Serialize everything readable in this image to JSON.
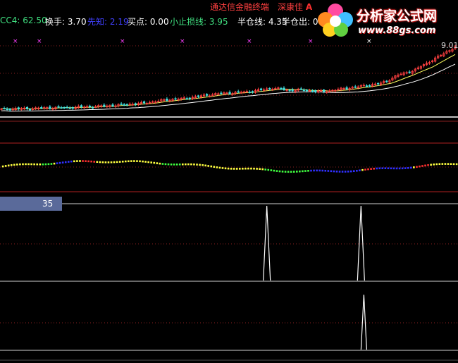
{
  "window": {
    "terminal_title": "通达信金融终端",
    "stock_name": "深康佳",
    "stock_flag": "A"
  },
  "indicators": [
    {
      "text": "CC4: 62.50",
      "color": "#40e080"
    },
    {
      "text": "换手: 3.70",
      "color": "#ffffff"
    },
    {
      "text": "先知: 2.19",
      "color": "#4040ff"
    },
    {
      "text": "买点: 0.00",
      "color": "#ffffff"
    },
    {
      "text": "小止损线: 3.95",
      "color": "#40e080"
    },
    {
      "text": "半仓线: 4.35",
      "color": "#ffffff"
    },
    {
      "text": "半仓出: 0",
      "color": "#ffffff"
    }
  ],
  "watermark": {
    "name": "分析家公式网",
    "url": "www.88gs.com"
  },
  "price_label": "9.01",
  "box_label": "35",
  "chart_data": [
    {
      "type": "candlestick",
      "panel": "main-kline",
      "bars": 160,
      "close_series": [
        3.7,
        3.72,
        3.75,
        3.73,
        3.78,
        3.8,
        3.82,
        3.85,
        3.83,
        3.87,
        3.9,
        3.92,
        3.95,
        4.0,
        4.05,
        4.1,
        4.15,
        4.2,
        4.3,
        4.4,
        4.5,
        4.55,
        4.6,
        4.7,
        4.8,
        4.9,
        5.0,
        5.05,
        5.1,
        5.15,
        5.2,
        5.3,
        5.4,
        5.5,
        5.4,
        5.3,
        5.35,
        5.3,
        5.25,
        5.2,
        5.3,
        5.4,
        5.5,
        5.6,
        5.7,
        5.8,
        5.9,
        6.2,
        6.6,
        6.8,
        7.0,
        7.4,
        7.8,
        8.2,
        8.6,
        9.01
      ],
      "moving_average_colors": [
        "#ffff60",
        "#ffffff"
      ]
    },
    {
      "type": "scatter",
      "panel": "color-dot-band",
      "colors": {
        "up": "#ffff40",
        "strong": "#40ff40",
        "weak": "#3030ff",
        "down": "#ff3030"
      }
    },
    {
      "type": "line",
      "panel": "spike-panel-1",
      "ylim": [
        0,
        35
      ],
      "spikes": [
        {
          "bar": 93,
          "value": 35
        },
        {
          "bar": 126,
          "value": 35
        }
      ]
    },
    {
      "type": "line",
      "panel": "spike-panel-2",
      "ylim": [
        0,
        1
      ],
      "spikes": [
        {
          "bar": 127,
          "value": 1
        }
      ]
    }
  ]
}
